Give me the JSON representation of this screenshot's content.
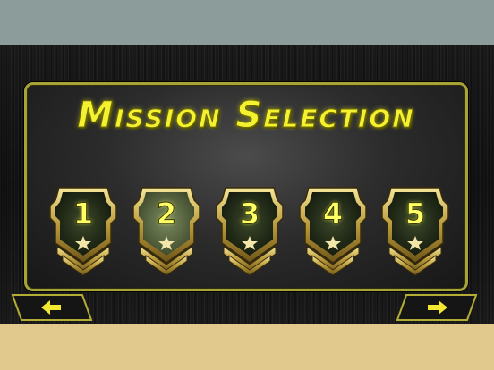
{
  "title": "Mission Selection",
  "missions": [
    {
      "number": "1",
      "selected": false
    },
    {
      "number": "2",
      "selected": true
    },
    {
      "number": "3",
      "selected": false
    },
    {
      "number": "4",
      "selected": false
    },
    {
      "number": "5",
      "selected": false
    }
  ],
  "nav": {
    "prev_icon": "arrow-left-icon",
    "next_icon": "arrow-right-icon"
  },
  "colors": {
    "accent_yellow": "#f4f230",
    "panel_border": "#a8a336",
    "top_band": "#8c9c9b",
    "bottom_band": "#e1c98e"
  }
}
